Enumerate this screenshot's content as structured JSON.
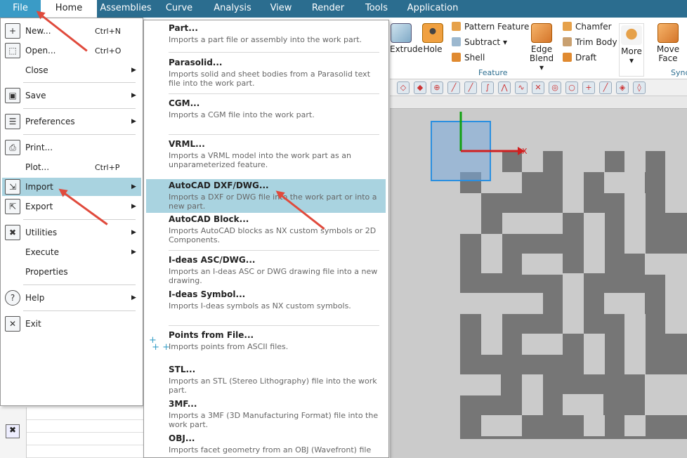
{
  "menubar": {
    "tabs": [
      "File",
      "Home",
      "Assemblies",
      "Curve",
      "Analysis",
      "View",
      "Render",
      "Tools",
      "Application"
    ]
  },
  "ribbon": {
    "extrude_label": "Extrude",
    "hole_label": "Hole",
    "pattern_feature": "Pattern Feature",
    "subtract": "Subtract",
    "shell": "Shell",
    "edge_blend": "Edge",
    "edge_blend2": "Blend",
    "chamfer": "Chamfer",
    "trim_body": "Trim Body",
    "draft": "Draft",
    "more": "More",
    "move_face": "Move",
    "move_face2": "Face",
    "feature_group": "Feature",
    "sync_group": "Sync"
  },
  "file_menu": {
    "items": [
      {
        "label": "New...",
        "shortcut": "Ctrl+N",
        "arrow": "",
        "icon": "new-icon"
      },
      {
        "label": "Open...",
        "shortcut": "Ctrl+O",
        "arrow": "",
        "icon": "open-icon"
      },
      {
        "label": "Close",
        "shortcut": "",
        "arrow": "▶",
        "icon": ""
      },
      {
        "label": "Save",
        "shortcut": "",
        "arrow": "▶",
        "icon": "save-icon"
      },
      {
        "label": "Preferences",
        "shortcut": "",
        "arrow": "▶",
        "icon": "preferences-icon"
      },
      {
        "label": "Print...",
        "shortcut": "",
        "arrow": "",
        "icon": "print-icon"
      },
      {
        "label": "Plot...",
        "shortcut": "Ctrl+P",
        "arrow": "",
        "icon": ""
      },
      {
        "label": "Import",
        "shortcut": "",
        "arrow": "▶",
        "icon": "import-icon"
      },
      {
        "label": "Export",
        "shortcut": "",
        "arrow": "▶",
        "icon": "export-icon"
      },
      {
        "label": "Utilities",
        "shortcut": "",
        "arrow": "▶",
        "icon": "utilities-icon"
      },
      {
        "label": "Execute",
        "shortcut": "",
        "arrow": "▶",
        "icon": ""
      },
      {
        "label": "Properties",
        "shortcut": "",
        "arrow": "",
        "icon": ""
      },
      {
        "label": "Help",
        "shortcut": "",
        "arrow": "▶",
        "icon": "help-icon"
      },
      {
        "label": "Exit",
        "shortcut": "",
        "arrow": "",
        "icon": "exit-icon"
      }
    ]
  },
  "import_menu": {
    "items": [
      {
        "title": "Part...",
        "desc": "Imports a part file or assembly into the work part."
      },
      {
        "title": "Parasolid...",
        "desc": "Imports solid and sheet bodies from a Parasolid text file into the work part."
      },
      {
        "title": "CGM...",
        "desc": "Imports a CGM file into the work part."
      },
      {
        "title": "VRML...",
        "desc": "Imports a VRML model into the work part as an unparameterized feature."
      },
      {
        "title": "AutoCAD DXF/DWG...",
        "desc": "Imports a DXF or DWG file into the work part or into a new part."
      },
      {
        "title": "AutoCAD Block...",
        "desc": "Imports AutoCAD blocks as NX custom symbols or 2D Components."
      },
      {
        "title": "I-deas ASC/DWG...",
        "desc": "Imports an I-deas ASC or DWG drawing file into a new drawing."
      },
      {
        "title": "I-deas Symbol...",
        "desc": "Imports I-deas symbols as NX custom symbols."
      },
      {
        "title": "Points from File...",
        "desc": "Imports points from ASCII files."
      },
      {
        "title": "STL...",
        "desc": "Imports an STL (Stereo Lithography) file into the work part."
      },
      {
        "title": "3MF...",
        "desc": "Imports a 3MF (3D Manufacturing Format) file into the work part."
      },
      {
        "title": "OBJ...",
        "desc": "Imports facet geometry from an OBJ (Wavefront) file"
      }
    ]
  },
  "viewport": {
    "axis_x": "X"
  },
  "colors": {
    "accent": "#2b6d8f",
    "highlight": "#a9d3e0",
    "annotation_arrow": "#e04a3c",
    "model": "#767676"
  }
}
